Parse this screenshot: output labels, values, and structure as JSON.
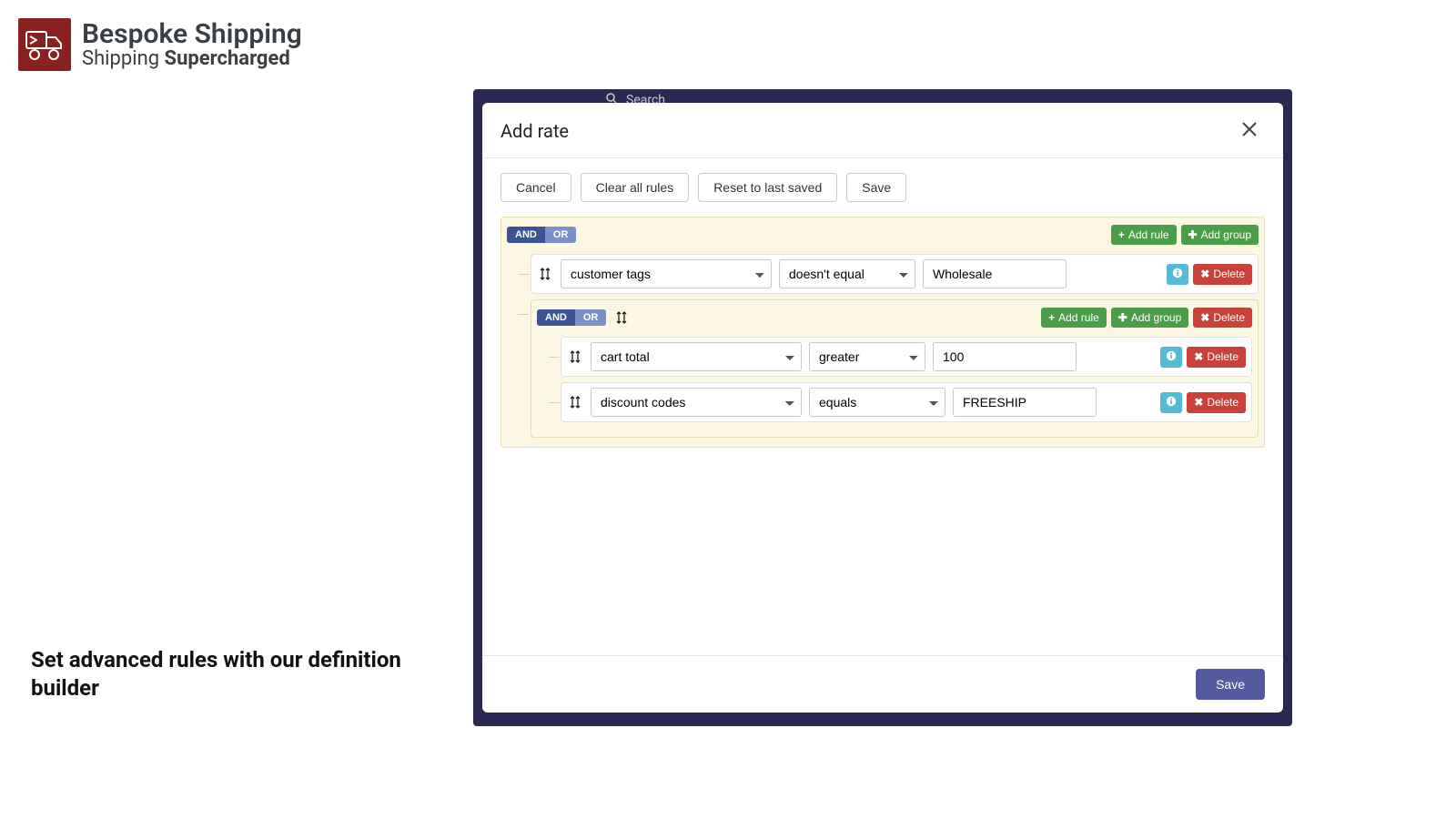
{
  "brand": {
    "title": "Bespoke Shipping",
    "subtitle_prefix": "Shipping ",
    "subtitle_bold": "Supercharged"
  },
  "caption": "Set advanced rules with our definition builder",
  "backdrop": {
    "search_placeholder": "Search"
  },
  "modal": {
    "title": "Add rate",
    "toolbar": {
      "cancel": "Cancel",
      "clear": "Clear all rules",
      "reset": "Reset to last saved",
      "save": "Save"
    },
    "cond_labels": {
      "and": "AND",
      "or": "OR"
    },
    "btn_labels": {
      "add_rule": "Add rule",
      "add_group": "Add group",
      "delete": "Delete"
    },
    "group": {
      "cond": "AND",
      "rules": [
        {
          "field": "customer tags",
          "operator": "doesn't equal",
          "value": "Wholesale"
        }
      ],
      "nested": {
        "cond": "AND",
        "rules": [
          {
            "field": "cart total",
            "operator": "greater",
            "value": "100"
          },
          {
            "field": "discount codes",
            "operator": "equals",
            "value": "FREESHIP"
          }
        ]
      }
    },
    "footer_save": "Save"
  }
}
